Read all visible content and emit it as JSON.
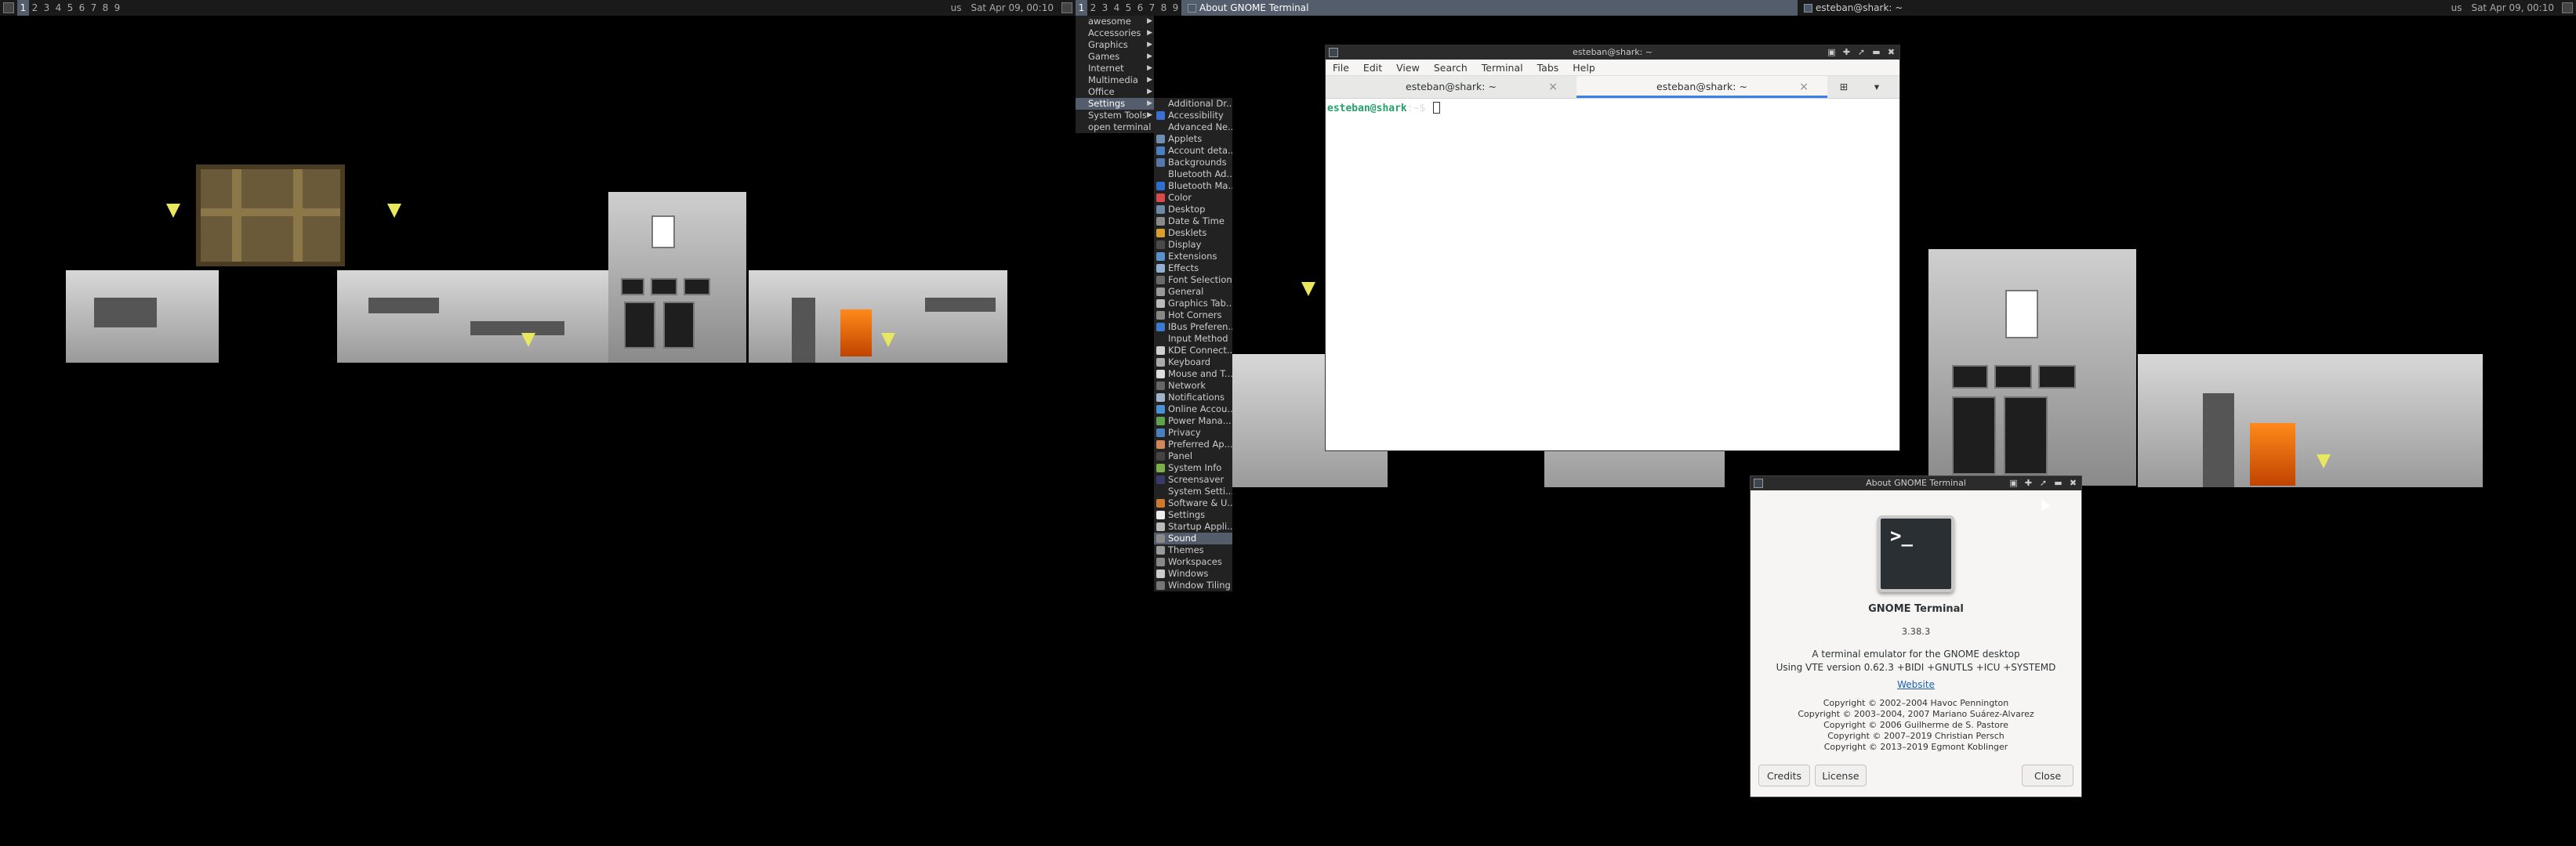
{
  "screens": {
    "left": {
      "tags": [
        "1",
        "2",
        "3",
        "4",
        "5",
        "6",
        "7",
        "8",
        "9"
      ],
      "selected_tag": "1",
      "keyboard": "us",
      "clock": "Sat Apr 09, 00:10"
    },
    "right": {
      "tags": [
        "1",
        "2",
        "3",
        "4",
        "5",
        "6",
        "7",
        "8",
        "9"
      ],
      "selected_tag": "1",
      "tasks": [
        {
          "label": "About GNOME Terminal",
          "focused": true
        },
        {
          "label": "esteban@shark: ~",
          "focused": false
        }
      ],
      "keyboard": "us",
      "clock": "Sat Apr 09, 00:10"
    }
  },
  "main_menu": {
    "items": [
      {
        "label": "awesome",
        "submenu": true
      },
      {
        "label": "Accessories",
        "submenu": true
      },
      {
        "label": "Graphics",
        "submenu": true
      },
      {
        "label": "Games",
        "submenu": true
      },
      {
        "label": "Internet",
        "submenu": true
      },
      {
        "label": "Multimedia",
        "submenu": true
      },
      {
        "label": "Office",
        "submenu": true
      },
      {
        "label": "Settings",
        "submenu": true,
        "selected": true
      },
      {
        "label": "System Tools",
        "submenu": true
      },
      {
        "label": "open terminal",
        "submenu": false
      }
    ]
  },
  "settings_menu": {
    "items": [
      {
        "label": "Additional Dr...",
        "color": ""
      },
      {
        "label": "Accessibility",
        "color": "#3b6fd1"
      },
      {
        "label": "Advanced Ne...",
        "color": ""
      },
      {
        "label": "Applets",
        "color": "#6f8fb0"
      },
      {
        "label": "Account deta...",
        "color": "#4a7fc0"
      },
      {
        "label": "Backgrounds",
        "color": "#5577aa"
      },
      {
        "label": "Bluetooth Ad...",
        "color": ""
      },
      {
        "label": "Bluetooth Ma...",
        "color": "#2f6fd0"
      },
      {
        "label": "Color",
        "color": "#d84a4a"
      },
      {
        "label": "Desktop",
        "color": "#6d8aa8"
      },
      {
        "label": "Date & Time",
        "color": "#8a8a8a"
      },
      {
        "label": "Desklets",
        "color": "#d9a030"
      },
      {
        "label": "Display",
        "color": "#4a4a4a"
      },
      {
        "label": "Extensions",
        "color": "#5a8fd0"
      },
      {
        "label": "Effects",
        "color": "#8fb0d0"
      },
      {
        "label": "Font Selection",
        "color": "#6a6a6a"
      },
      {
        "label": "General",
        "color": "#9a9a9a"
      },
      {
        "label": "Graphics Tab...",
        "color": "#bbbbbb"
      },
      {
        "label": "Hot Corners",
        "color": "#888888"
      },
      {
        "label": "IBus Preferen...",
        "color": "#3a7ad0"
      },
      {
        "label": "Input Method",
        "color": ""
      },
      {
        "label": "KDE Connect...",
        "color": "#cfcfcf"
      },
      {
        "label": "Keyboard",
        "color": "#aaaaaa"
      },
      {
        "label": "Mouse and T...",
        "color": "#dddddd"
      },
      {
        "label": "Network",
        "color": "#666666"
      },
      {
        "label": "Notifications",
        "color": "#9fb4cc"
      },
      {
        "label": "Online Accou...",
        "color": "#4a90d9"
      },
      {
        "label": "Power Mana...",
        "color": "#5ea34a"
      },
      {
        "label": "Privacy",
        "color": "#4a7fc0"
      },
      {
        "label": "Preferred Ap...",
        "color": "#d0885a"
      },
      {
        "label": "Panel",
        "color": "#444444"
      },
      {
        "label": "System Info",
        "color": "#7ab04a"
      },
      {
        "label": "Screensaver",
        "color": "#3a3a6a"
      },
      {
        "label": "System Setti...",
        "color": ""
      },
      {
        "label": "Software & U...",
        "color": "#d07a30"
      },
      {
        "label": "Settings",
        "color": "#eeeeee"
      },
      {
        "label": "Startup Appli...",
        "color": "#bbbbbb"
      },
      {
        "label": "Sound",
        "color": "#8a8a8a",
        "selected": true
      },
      {
        "label": "Themes",
        "color": "#9a9a9a"
      },
      {
        "label": "Workspaces",
        "color": "#888888"
      },
      {
        "label": "Windows",
        "color": "#cccccc"
      },
      {
        "label": "Window Tiling",
        "color": "#777777"
      }
    ]
  },
  "terminal": {
    "title": "esteban@shark: ~",
    "menu": [
      "File",
      "Edit",
      "View",
      "Search",
      "Terminal",
      "Tabs",
      "Help"
    ],
    "tabs": [
      {
        "label": "esteban@shark: ~",
        "active": false
      },
      {
        "label": "esteban@shark: ~",
        "active": true
      }
    ],
    "prompt": "esteban@shark",
    "prompt_path": ":~$"
  },
  "about": {
    "title": "About GNOME Terminal",
    "logo_glyph": ">_",
    "name": "GNOME Terminal",
    "version": "3.38.3",
    "desc1": "A terminal emulator for the GNOME desktop",
    "desc2": "Using VTE version 0.62.3 +BIDI +GNUTLS +ICU +SYSTEMD",
    "website": "Website",
    "copyright": [
      "Copyright © 2002–2004 Havoc Pennington",
      "Copyright © 2003–2004, 2007 Mariano Suárez-Alvarez",
      "Copyright © 2006 Guilherme de S. Pastore",
      "Copyright © 2007–2019 Christian Persch",
      "Copyright © 2013–2019 Egmont Koblinger"
    ],
    "buttons": {
      "credits": "Credits",
      "license": "License",
      "close": "Close"
    }
  }
}
